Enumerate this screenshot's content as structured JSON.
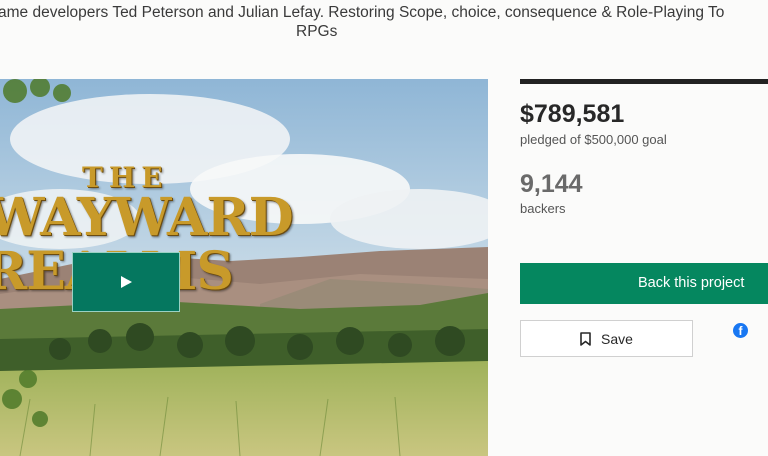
{
  "project": {
    "blurb_line1": "ame developers Ted Peterson and Julian Lefay. Restoring Scope, choice, consequence & Role-Playing To",
    "blurb_line2": "RPGs"
  },
  "video": {
    "logo_the": "THE",
    "logo_word1": "WAYWARD",
    "logo_word2": "REALMS",
    "play_icon": "play-icon"
  },
  "stats": {
    "pledged": "$789,581",
    "pledged_label": "pledged of $500,000 goal",
    "backers": "9,144",
    "backers_label": "backers"
  },
  "actions": {
    "back_label": "Back this project",
    "save_label": "Save",
    "save_icon": "bookmark-icon",
    "share_icon": "facebook-icon"
  },
  "colors": {
    "accent": "#05875f",
    "play_button": "#05775f",
    "facebook": "#1877f2"
  }
}
